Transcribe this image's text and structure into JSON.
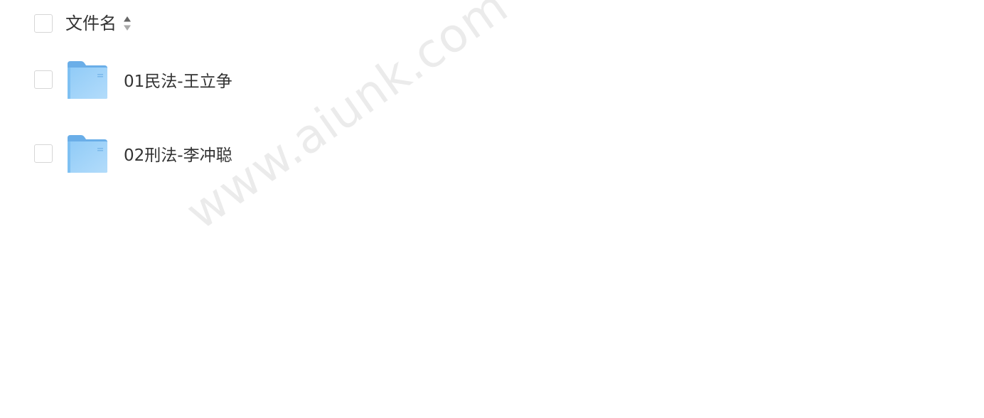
{
  "header": {
    "column_label": "文件名"
  },
  "files": [
    {
      "name": "01民法-王立争",
      "type": "folder"
    },
    {
      "name": "02刑法-李冲聪",
      "type": "folder"
    }
  ],
  "watermark": "www.aiunk.com",
  "colors": {
    "folder_light": "#9fd2f8",
    "folder_dark": "#6aaee8",
    "checkbox_border": "#d6d6d6",
    "text": "#333333"
  },
  "icons": {
    "sort": "sort-icon",
    "folder": "folder-icon"
  }
}
